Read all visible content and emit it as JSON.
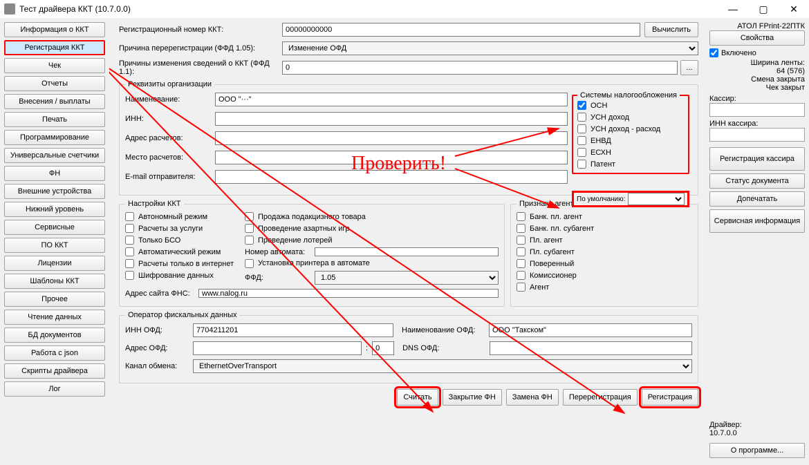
{
  "window": {
    "title": "Тест драйвера ККТ (10.7.0.0)"
  },
  "leftnav": {
    "items": [
      "Информация о ККТ",
      "Регистрация ККТ",
      "Чек",
      "Отчеты",
      "Внесения / выплаты",
      "Печать",
      "Программирование",
      "Универсальные счетчики",
      "ФН",
      "Внешние устройства",
      "Нижний уровень",
      "Сервисные",
      "ПО ККТ",
      "Лицензии",
      "Шаблоны ККТ",
      "Прочее",
      "Чтение данных",
      "БД документов",
      "Работа с json",
      "Скрипты драйвера",
      "Лог"
    ],
    "active_index": 1
  },
  "top_fields": {
    "reg_label": "Регистрационный номер ККТ:",
    "reg_value": "00000000000",
    "calc_btn": "Вычислить",
    "rereg_label": "Причина перерегистрации (ФФД 1.05):",
    "rereg_value": "Изменение ОФД",
    "changes_label": "Причины изменения сведений о ККТ (ФФД 1.1):",
    "changes_value": "0",
    "dots": "..."
  },
  "org": {
    "legend": "Реквизиты организации",
    "name_label": "Наименование:",
    "name_value": "ООО \"···\"",
    "inn_label": "ИНН:",
    "inn_value": "",
    "addr_label": "Адрес расчетов:",
    "addr_value": "",
    "place_label": "Место расчетов:",
    "place_value": "",
    "email_label": "E-mail отправителя:",
    "email_value": ""
  },
  "tax": {
    "legend": "Системы налогообложения",
    "items": [
      "ОСН",
      "УСН доход",
      "УСН доход - расход",
      "ЕНВД",
      "ЕСХН",
      "Патент"
    ],
    "checked": [
      true,
      false,
      false,
      false,
      false,
      false
    ],
    "default_label": "По умолчанию:",
    "default_value": ""
  },
  "kkt_settings": {
    "legend": "Настройки ККТ",
    "col1": [
      "Автономный режим",
      "Расчеты за услуги",
      "Только БСО",
      "Автоматический режим",
      "Расчеты только в интернет",
      "Шифрование данных"
    ],
    "col2": [
      "Продажа подакцизного товара",
      "Проведение азартных игр",
      "Проведение лотерей"
    ],
    "auto_num_label": "Номер автомата:",
    "auto_num_value": "",
    "printer_auto": "Установка принтера в автомате",
    "ffd_label": "ФФД:",
    "ffd_value": "1.05",
    "fns_label": "Адрес сайта ФНС:",
    "fns_value": "www.nalog.ru"
  },
  "agent": {
    "legend": "Признаки агента",
    "items": [
      "Банк. пл. агент",
      "Банк. пл. субагент",
      "Пл. агент",
      "Пл. субагент",
      "Поверенный",
      "Комиссионер",
      "Агент"
    ]
  },
  "ofd": {
    "legend": "Оператор фискальных данных",
    "inn_label": "ИНН ОФД:",
    "inn_value": "7704211201",
    "name_label": "Наименование ОФД:",
    "name_value": "ООО \"Такском\"",
    "addr_label": "Адрес ОФД:",
    "addr_value": "",
    "port_value": "0",
    "dns_label": "DNS ОФД:",
    "dns_value": "",
    "channel_label": "Канал обмена:",
    "channel_value": "EthernetOverTransport"
  },
  "bottom_buttons": [
    "Считать",
    "Закрытие ФН",
    "Замена ФН",
    "Перерегистрация",
    "Регистрация"
  ],
  "rightpane": {
    "device": "АТОЛ FPrint-22ПТК",
    "props_btn": "Свойства",
    "enabled_label": "Включено",
    "width_label": "Ширина ленты:",
    "width_value": "64 (576)",
    "shift_closed": "Смена закрыта",
    "check_closed": "Чек закрыт",
    "cashier_label": "Кассир:",
    "cashier_value": "",
    "cashier_inn_label": "ИНН кассира:",
    "cashier_inn_value": "",
    "reg_cashier_btn": "Регистрация кассира",
    "doc_status_btn": "Статус документа",
    "reprint_btn": "Допечатать",
    "service_info_btn": "Сервисная информация",
    "driver_label": "Драйвер:",
    "driver_value": "10.7.0.0",
    "about_btn": "О программе..."
  },
  "annotation": {
    "text": "Проверить!"
  }
}
